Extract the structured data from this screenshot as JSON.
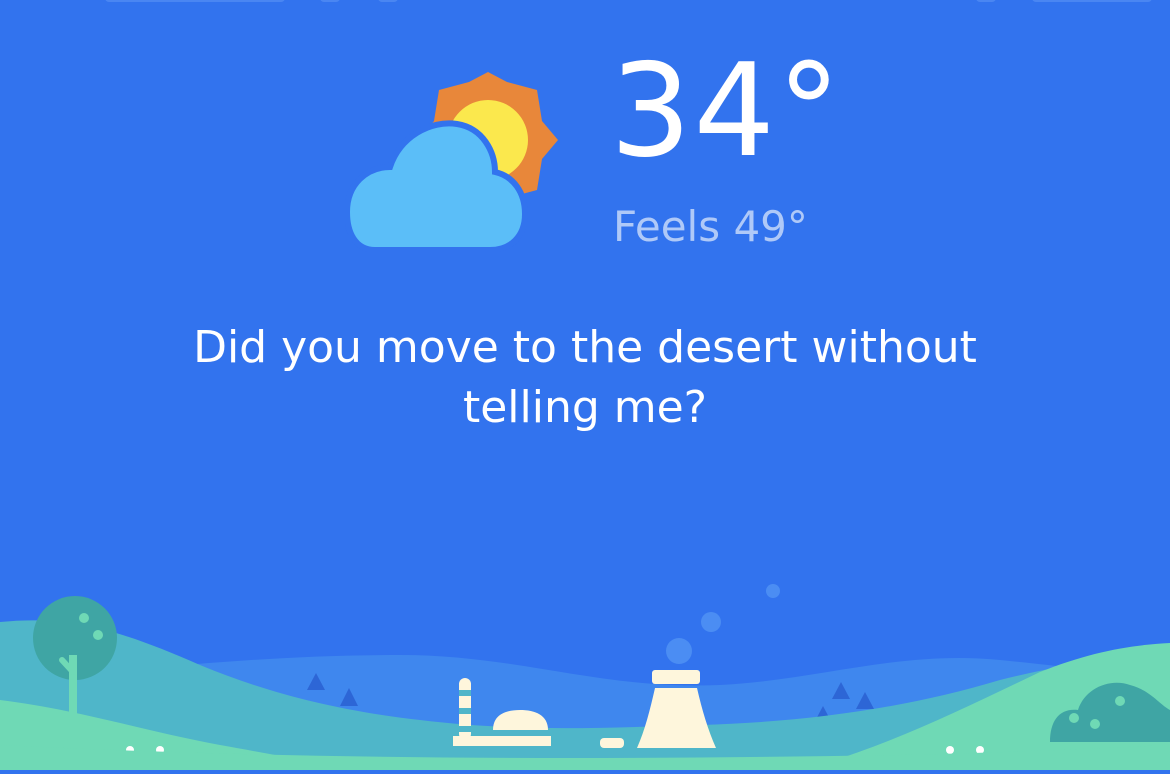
{
  "weather": {
    "condition_icon": "partly-sunny-icon",
    "temperature": "34°",
    "feels_like": "Feels 49°",
    "message": "Did you move to the desert without telling me?"
  },
  "colors": {
    "background": "#3273EE",
    "cloud": "#5BBEF8",
    "sun_outer": "#E8873A",
    "sun_inner": "#FBE84D",
    "hill_front": "#6FD9B5",
    "hill_mid": "#4FB6C9",
    "hill_back": "#3F87EE",
    "factory": "#FEF6DC"
  }
}
